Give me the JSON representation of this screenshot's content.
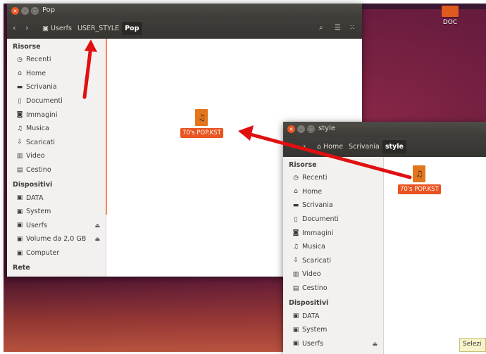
{
  "desktop": {
    "folder_label": "DOC",
    "tooltip_text": "Selezi"
  },
  "pop_window": {
    "title": "Pop",
    "breadcrumbs": [
      "Userfs",
      "USER_STYLE",
      "Pop"
    ],
    "file_name": "70's POP.KST",
    "sidebar": {
      "sections": [
        {
          "label": "Risorse",
          "items": [
            {
              "label": "Recenti",
              "icon": "clock-icon"
            },
            {
              "label": "Home",
              "icon": "home-icon"
            },
            {
              "label": "Scrivania",
              "icon": "folder-icon"
            },
            {
              "label": "Documenti",
              "icon": "document-icon"
            },
            {
              "label": "Immagini",
              "icon": "camera-icon"
            },
            {
              "label": "Musica",
              "icon": "music-icon"
            },
            {
              "label": "Scaricati",
              "icon": "download-icon"
            },
            {
              "label": "Video",
              "icon": "film-icon"
            },
            {
              "label": "Cestino",
              "icon": "trash-icon"
            }
          ]
        },
        {
          "label": "Dispositivi",
          "items": [
            {
              "label": "DATA",
              "icon": "drive-icon"
            },
            {
              "label": "System",
              "icon": "drive-icon"
            },
            {
              "label": "Userfs",
              "icon": "drive-icon",
              "eject": true
            },
            {
              "label": "Volume da 2,0 GB",
              "icon": "drive-icon",
              "eject": true
            },
            {
              "label": "Computer",
              "icon": "drive-icon"
            }
          ]
        },
        {
          "label": "Rete",
          "items": []
        }
      ]
    }
  },
  "style_window": {
    "title": "style",
    "breadcrumbs": [
      "Home",
      "Scrivania",
      "style"
    ],
    "file_name": "70's POP.KST",
    "sidebar": {
      "sections": [
        {
          "label": "Risorse",
          "items": [
            {
              "label": "Recenti",
              "icon": "clock-icon"
            },
            {
              "label": "Home",
              "icon": "home-icon"
            },
            {
              "label": "Scrivania",
              "icon": "folder-icon"
            },
            {
              "label": "Documenti",
              "icon": "document-icon"
            },
            {
              "label": "Immagini",
              "icon": "camera-icon"
            },
            {
              "label": "Musica",
              "icon": "music-icon"
            },
            {
              "label": "Scaricati",
              "icon": "download-icon"
            },
            {
              "label": "Video",
              "icon": "film-icon"
            },
            {
              "label": "Cestino",
              "icon": "trash-icon"
            }
          ]
        },
        {
          "label": "Dispositivi",
          "items": [
            {
              "label": "DATA",
              "icon": "drive-icon"
            },
            {
              "label": "System",
              "icon": "drive-icon"
            },
            {
              "label": "Userfs",
              "icon": "drive-icon",
              "eject": true
            }
          ]
        }
      ]
    }
  },
  "colors": {
    "accent": "#e95420",
    "arrow": "#e01010",
    "file_icon": "#e2761d"
  }
}
